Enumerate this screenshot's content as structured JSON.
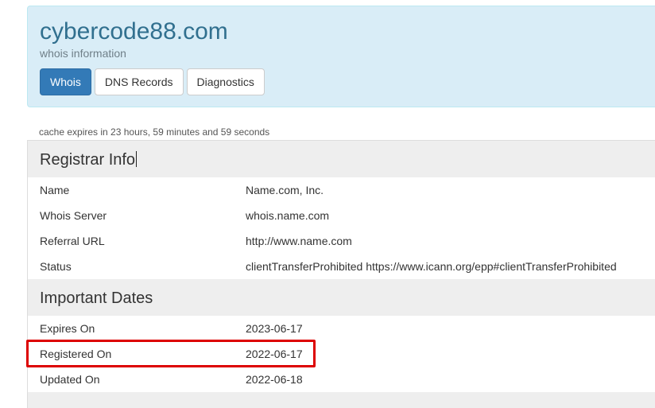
{
  "header": {
    "domain": "cybercode88.com",
    "subtitle": "whois information",
    "tabs": [
      {
        "label": "Whois",
        "active": true
      },
      {
        "label": "DNS Records",
        "active": false
      },
      {
        "label": "Diagnostics",
        "active": false
      }
    ]
  },
  "cache_note": "cache expires in 23 hours, 59 minutes and 59 seconds",
  "registrar": {
    "heading": "Registrar Info",
    "rows": [
      {
        "key": "Name",
        "value": "Name.com, Inc."
      },
      {
        "key": "Whois Server",
        "value": "whois.name.com"
      },
      {
        "key": "Referral URL",
        "value": "http://www.name.com"
      },
      {
        "key": "Status",
        "value": "clientTransferProhibited https://www.icann.org/epp#clientTransferProhibited"
      }
    ]
  },
  "dates": {
    "heading": "Important Dates",
    "rows": [
      {
        "key": "Expires On",
        "value": "2023-06-17"
      },
      {
        "key": "Registered On",
        "value": "2022-06-17"
      },
      {
        "key": "Updated On",
        "value": "2022-06-18"
      }
    ]
  },
  "colors": {
    "header_bg": "#d9edf7",
    "title": "#31708f",
    "active_tab": "#337ab7",
    "section_bg": "#eeeeee",
    "highlight": "#dd0000"
  }
}
